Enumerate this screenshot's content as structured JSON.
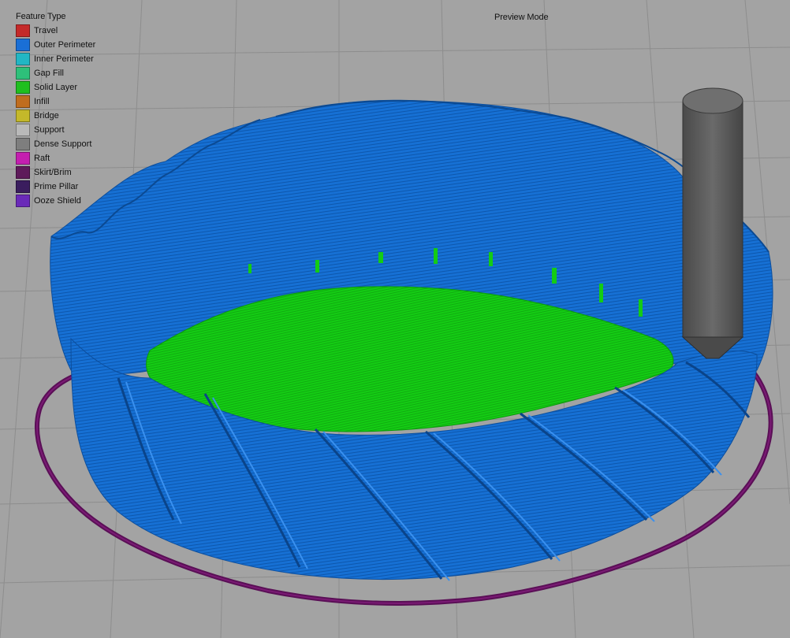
{
  "legend": {
    "title": "Feature Type",
    "items": [
      {
        "label": "Travel",
        "color": "#c42a2a",
        "icon": "travel-swatch"
      },
      {
        "label": "Outer Perimeter",
        "color": "#1a6fd6",
        "icon": "outer-perimeter-swatch"
      },
      {
        "label": "Inner Perimeter",
        "color": "#22b6c4",
        "icon": "inner-perimeter-swatch"
      },
      {
        "label": "Gap Fill",
        "color": "#2ec07a",
        "icon": "gap-fill-swatch"
      },
      {
        "label": "Solid Layer",
        "color": "#1fbf1f",
        "icon": "solid-layer-swatch"
      },
      {
        "label": "Infill",
        "color": "#c06d1e",
        "icon": "infill-swatch"
      },
      {
        "label": "Bridge",
        "color": "#c4b82a",
        "icon": "bridge-swatch"
      },
      {
        "label": "Support",
        "color": "#b9b9b9",
        "icon": "support-swatch"
      },
      {
        "label": "Dense Support",
        "color": "#7e7e7e",
        "icon": "dense-support-swatch"
      },
      {
        "label": "Raft",
        "color": "#c41fb0",
        "icon": "raft-swatch"
      },
      {
        "label": "Skirt/Brim",
        "color": "#5e1a5a",
        "icon": "skirt-brim-swatch"
      },
      {
        "label": "Prime Pillar",
        "color": "#3a1d5e",
        "icon": "prime-pillar-swatch"
      },
      {
        "label": "Ooze Shield",
        "color": "#6a2ab8",
        "icon": "ooze-shield-swatch"
      }
    ]
  },
  "header": {
    "mode_label": "Preview Mode"
  },
  "scene": {
    "model_color": "#1670d4",
    "solid_color": "#12c712",
    "skirt_color": "#5a0f56",
    "nozzle_color": "#5b5b5b",
    "grid_color": "#8f8f8f"
  }
}
